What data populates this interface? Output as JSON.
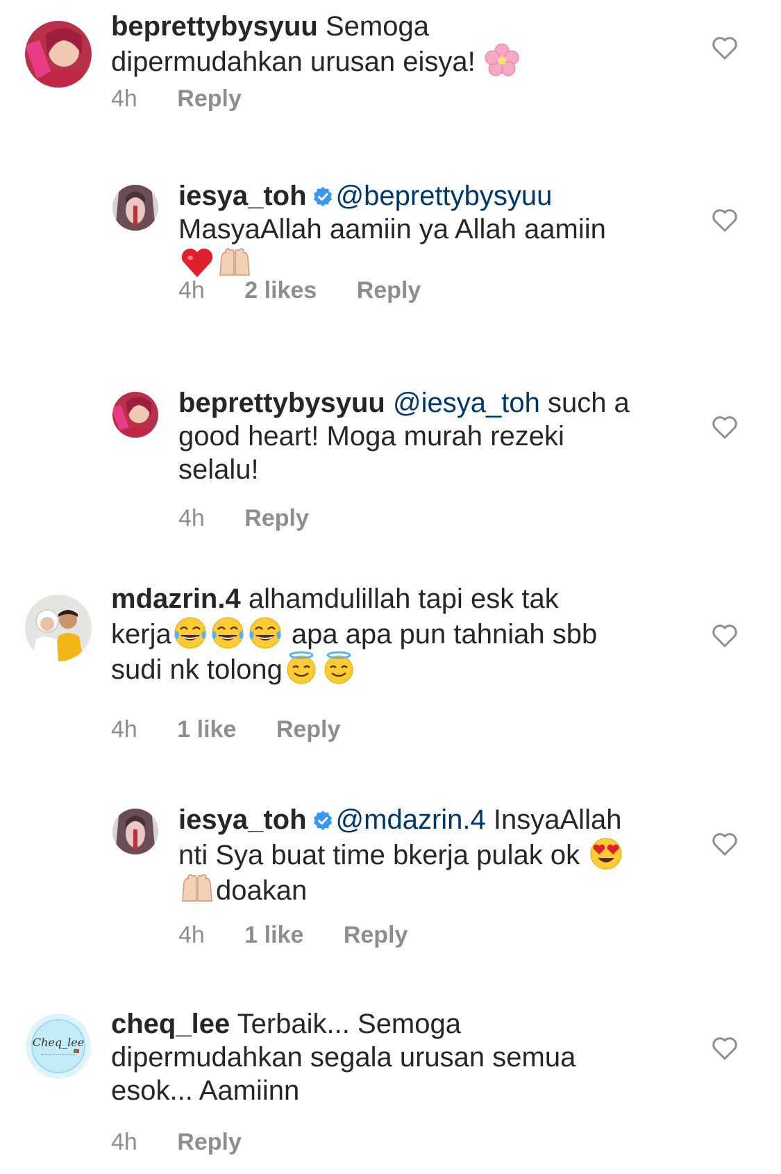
{
  "comments": [
    {
      "username": "beprettybysyuu",
      "text_lines": [
        "Semoga",
        "dipermudahkan urusan eisya!"
      ],
      "time": "4h",
      "reply_label": "Reply"
    },
    {
      "username": "iesya_toh",
      "mention": "@beprettybysyuu",
      "text_lines": [
        "MasyaAllah aamiin ya Allah aamiin"
      ],
      "time": "4h",
      "likes": "2 likes",
      "reply_label": "Reply"
    },
    {
      "username": "beprettybysyuu",
      "mention": "@iesya_toh",
      "text_lines": [
        "such a",
        "good heart! Moga murah rezeki",
        "selalu!"
      ],
      "time": "4h",
      "reply_label": "Reply"
    },
    {
      "username": "mdazrin.4",
      "text_lines": [
        "alhamdulillah tapi esk tak",
        "kerja",
        "apa apa pun tahniah sbb",
        "sudi nk tolong"
      ],
      "time": "4h",
      "likes": "1 like",
      "reply_label": "Reply"
    },
    {
      "username": "iesya_toh",
      "mention": "@mdazrin.4",
      "text_lines": [
        "InsyaAllah",
        "nti Sya buat time bkerja pulak ok",
        "doakan"
      ],
      "time": "4h",
      "likes": "1 like",
      "reply_label": "Reply"
    },
    {
      "username": "cheq_lee",
      "text_lines": [
        "Terbaik... Semoga",
        "dipermudahkan segala urusan semua",
        "esok... Aamiinn"
      ],
      "time": "4h",
      "reply_label": "Reply"
    }
  ],
  "colors": {
    "text": "#262626",
    "secondary": "#8e8e8e",
    "mention": "#00376b",
    "verified": "#3897f0"
  },
  "icons": [
    "heart-outline-icon",
    "verified-badge-icon",
    "cherry-blossom-emoji",
    "red-heart-emoji",
    "raised-hands-emoji",
    "tears-of-joy-emoji",
    "halo-smile-emoji",
    "heart-eyes-emoji"
  ]
}
